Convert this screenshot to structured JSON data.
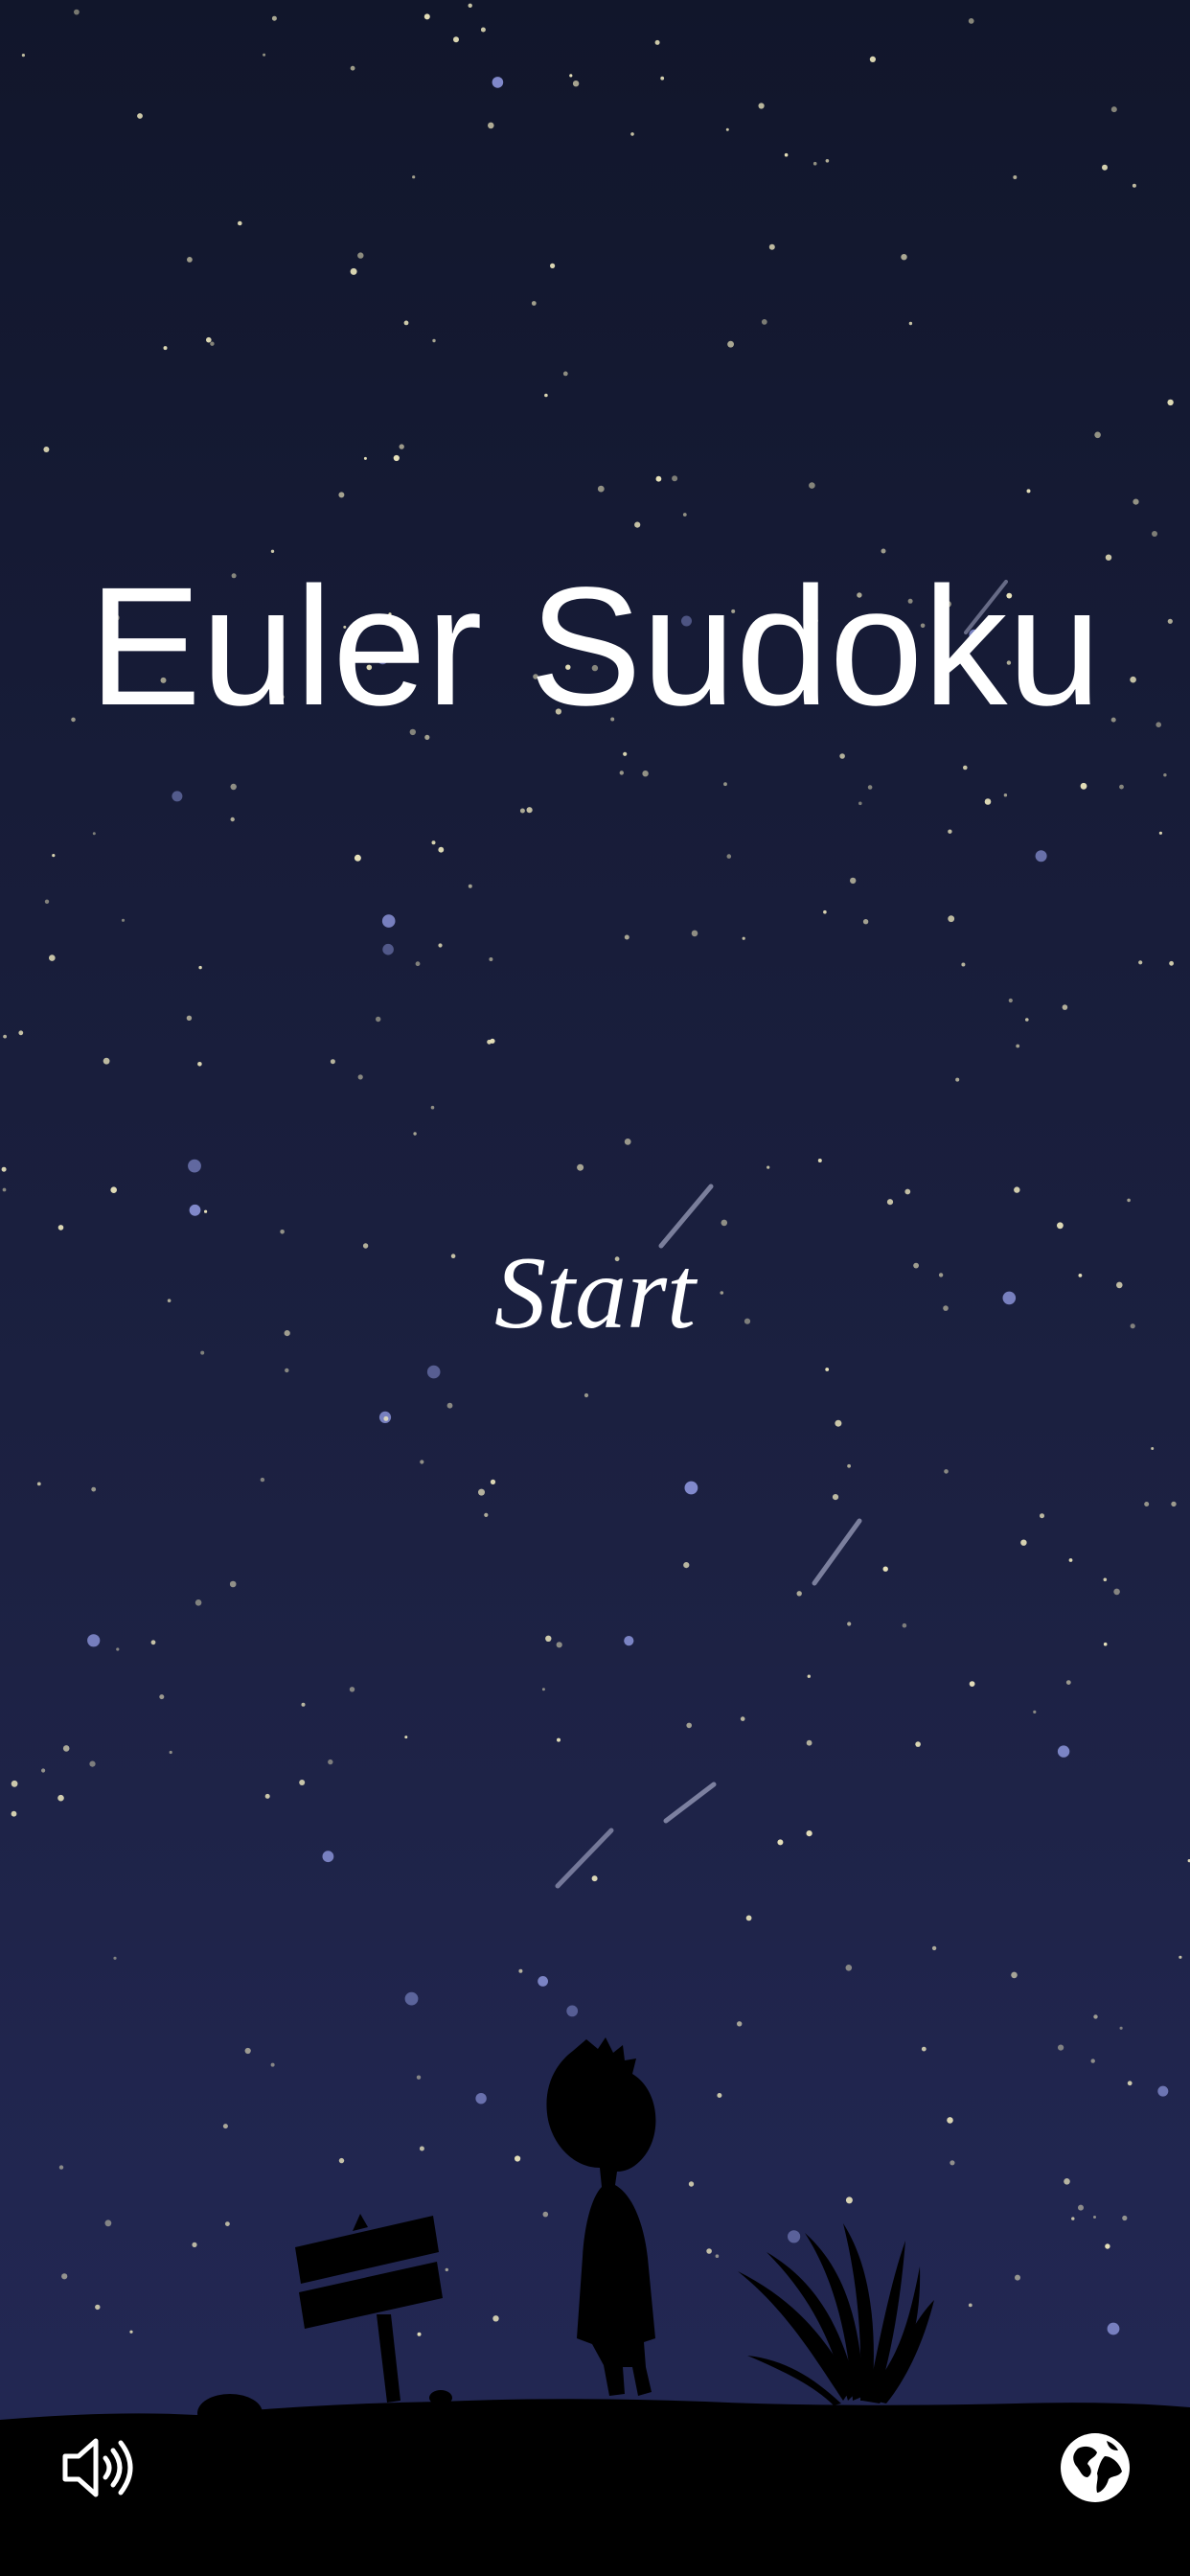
{
  "app": {
    "title": "Euler Sudoku"
  },
  "menu": {
    "start_label": "Start"
  },
  "controls": {
    "sound_icon": "speaker-volume-icon",
    "language_icon": "globe-icon"
  },
  "colors": {
    "sky_top": "#11162b",
    "sky_bottom": "#232854",
    "text": "#ffffff",
    "ground": "#000000",
    "star": "#f3edc2",
    "star_blue": "#8a93d8"
  }
}
